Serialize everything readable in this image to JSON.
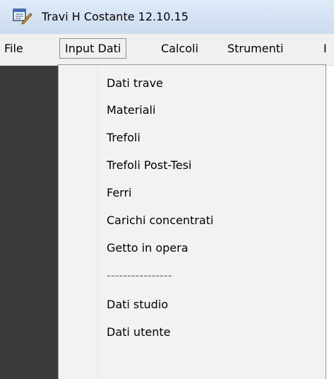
{
  "window": {
    "title": "Travi H Costante  12.10.15",
    "icon": "app-notepad-pencil-icon"
  },
  "menubar": {
    "items": [
      {
        "label": "File"
      },
      {
        "label": "Input Dati"
      },
      {
        "label": "Calcoli"
      },
      {
        "label": "Strumenti"
      },
      {
        "label": "I"
      }
    ]
  },
  "dropdown": {
    "items": [
      {
        "label": "Dati trave"
      },
      {
        "label": "Materiali"
      },
      {
        "label": "Trefoli"
      },
      {
        "label": "Trefoli Post-Tesi"
      },
      {
        "label": "Ferri"
      },
      {
        "label": "Carichi concentrati"
      },
      {
        "label": "Getto in opera"
      },
      {
        "label": "----------------"
      },
      {
        "label": "Dati studio"
      },
      {
        "label": "Dati utente"
      }
    ]
  }
}
